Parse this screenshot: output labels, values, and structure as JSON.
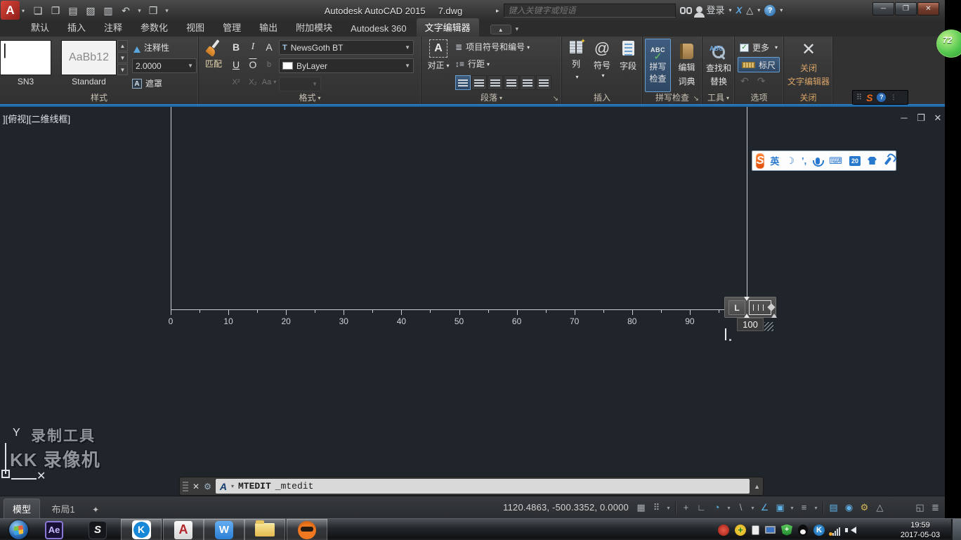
{
  "titlebar": {
    "app_button_label": "A",
    "title_app": "Autodesk AutoCAD 2015",
    "title_doc": "7.dwg",
    "search_placeholder": "键入关键字或短语",
    "signin_label": "登录",
    "exchange_glyph": "X",
    "a360_glyph": "△",
    "help_glyph": "?",
    "quick_access": [
      {
        "name": "qat-new-icon",
        "glyph": "❏"
      },
      {
        "name": "qat-open-icon",
        "glyph": "❐"
      },
      {
        "name": "qat-save-icon",
        "glyph": "▤"
      },
      {
        "name": "qat-saveas-icon",
        "glyph": "▨"
      },
      {
        "name": "qat-plot-icon",
        "glyph": "▥"
      },
      {
        "name": "qat-undo-icon",
        "glyph": "↶"
      },
      {
        "name": "qat-undo-caret-icon",
        "glyph": "▾",
        "sm": true
      },
      {
        "name": "qat-publish-icon",
        "glyph": "❒"
      },
      {
        "name": "qat-customize-caret-icon",
        "glyph": "▾",
        "sm": true
      }
    ],
    "window_buttons": {
      "minimize": "─",
      "restore": "❐",
      "close": "✕"
    }
  },
  "ribbon": {
    "tabs": [
      {
        "id": "home",
        "label": "默认"
      },
      {
        "id": "insert",
        "label": "插入"
      },
      {
        "id": "annotate",
        "label": "注释"
      },
      {
        "id": "parametric",
        "label": "参数化"
      },
      {
        "id": "view",
        "label": "视图"
      },
      {
        "id": "manage",
        "label": "管理"
      },
      {
        "id": "output",
        "label": "输出"
      },
      {
        "id": "addins",
        "label": "附加模块"
      },
      {
        "id": "autodesk-360",
        "label": "Autodesk 360"
      },
      {
        "id": "text-editor",
        "label": "文字编辑器",
        "active": true
      }
    ],
    "panels": {
      "style": {
        "label": "样式",
        "style1_preview": "|",
        "style1_name": "SN3",
        "style2_preview": "AaBb12",
        "style2_name": "Standard",
        "annotative_label": "注释性",
        "height_value": "2.0000",
        "mask_label": "遮罩"
      },
      "format": {
        "label": "格式",
        "match_label": "匹配",
        "bold": "B",
        "italic": "I",
        "tracking": "A",
        "underline": "U",
        "overline": "O",
        "stack": "b",
        "superscript": "X²",
        "subscript": "X₂",
        "case": "Aa",
        "font_icon": "T",
        "font_name": "NewsGoth BT",
        "color_name": "ByLayer"
      },
      "paragraph": {
        "label": "段落",
        "justify_label": "对正",
        "justify_glyph": "A",
        "bullets_label": "项目符号和编号",
        "spacing_label": "行距",
        "align_buttons": [
          "align-default-button",
          "align-left-button",
          "align-center-button",
          "align-right-button",
          "align-justify-button",
          "align-distribute-button"
        ]
      },
      "insert": {
        "label": "插入",
        "columns_label": "列",
        "symbol_label": "符号",
        "symbol_glyph": "@",
        "field_label": "字段"
      },
      "spellcheck": {
        "label": "拼写检查",
        "check_abc": "ABC",
        "check_mark": "✓",
        "check_line1": "拼写",
        "check_line2": "检查",
        "dict_line1": "编辑",
        "dict_line2": "词典"
      },
      "tools": {
        "label": "工具",
        "find_abc": "ABC",
        "find_line1": "查找和",
        "find_line2": "替换"
      },
      "options": {
        "label": "选项",
        "more_label": "更多",
        "check_glyph": "✓",
        "ruler_label": "标尺",
        "undo_glyph": "↶",
        "redo_glyph": "↷"
      },
      "close": {
        "label": "关闭",
        "close_glyph": "✕",
        "button_line1": "关闭",
        "button_line2": "文字编辑器"
      }
    },
    "sogou_status": {
      "dots": "⠿",
      "logo": "S",
      "help": "?"
    }
  },
  "viewport": {
    "view_label": "][俯视][二维线框]",
    "window_buttons": {
      "minimize": "─",
      "restore": "❐",
      "close": "✕"
    },
    "ruler": {
      "min": 0,
      "max": 100,
      "major_step": 10,
      "minor_step": 5,
      "labels": [
        "0",
        "10",
        "20",
        "30",
        "40",
        "50",
        "60",
        "70",
        "80",
        "90",
        "100"
      ]
    },
    "width_grip": {
      "tab_label": "L",
      "tooltip": "100"
    },
    "watermark": [
      "录制工具",
      "KK 录像机"
    ],
    "ucs": {
      "y_label": "Y",
      "x_label": "✕"
    }
  },
  "sogou_toolbar": {
    "logo": "S",
    "icons": [
      {
        "name": "sogou-mode-english",
        "glyph": "英",
        "type": "txt"
      },
      {
        "name": "sogou-halfwidth-moon-icon",
        "glyph": "☽",
        "type": "txt"
      },
      {
        "name": "sogou-punctuation-icon",
        "glyph": "’,",
        "type": "txt"
      },
      {
        "name": "sogou-mic-icon",
        "type": "mic"
      },
      {
        "name": "sogou-keyboard-icon",
        "glyph": "⌨",
        "type": "txt"
      },
      {
        "name": "sogou-anniversary-badge",
        "glyph": "20",
        "type": "badge"
      },
      {
        "name": "sogou-skin-icon",
        "type": "shirt"
      },
      {
        "name": "sogou-settings-wrench-icon",
        "type": "wrench"
      }
    ]
  },
  "command_line": {
    "close_glyph": "✕",
    "tool_glyph": "⚙",
    "pen_glyph": "A",
    "command": "MTEDIT",
    "echo": "_mtedit",
    "expand_glyph": "▲"
  },
  "status_bar": {
    "model_tab": "模型",
    "layout_tab": "布局1",
    "add_tab_glyph": "✦",
    "coordinates": "1120.4863, -500.3352, 0.0000",
    "icons": [
      {
        "name": "grid-display-icon",
        "glyph": "▦"
      },
      {
        "name": "snap-mode-icon",
        "glyph": "⠿"
      },
      {
        "name": "snap-caret-icon",
        "glyph": "▾",
        "caret": true
      },
      {
        "name": "statusbar-separator",
        "sep": true
      },
      {
        "name": "dynamic-input-icon",
        "glyph": "+"
      },
      {
        "name": "ortho-mode-icon",
        "glyph": "∟"
      },
      {
        "name": "polar-tracking-icon",
        "glyph": "◔",
        "accent": "blue"
      },
      {
        "name": "polar-caret-icon",
        "glyph": "▾",
        "caret": true
      },
      {
        "name": "isometric-drafting-icon",
        "glyph": "\\"
      },
      {
        "name": "iso-caret-icon",
        "glyph": "▾",
        "caret": true
      },
      {
        "name": "osnap-tracking-icon",
        "glyph": "∠",
        "accent": "blue"
      },
      {
        "name": "object-snap-icon",
        "glyph": "▣",
        "accent": "blue"
      },
      {
        "name": "osnap-caret-icon",
        "glyph": "▾",
        "caret": true
      },
      {
        "name": "lineweight-icon",
        "glyph": "≡"
      },
      {
        "name": "lineweight-caret-icon",
        "glyph": "▾",
        "caret": true
      },
      {
        "name": "statusbar-separator",
        "sep": true
      },
      {
        "name": "annotation-visibility-icon",
        "glyph": "▤",
        "accent": "blue"
      },
      {
        "name": "annotation-scale-icon",
        "glyph": "◉",
        "accent": "blue"
      },
      {
        "name": "workspace-switching-icon",
        "glyph": "⚙",
        "accent": "gold"
      },
      {
        "name": "annotation-monitor-icon",
        "glyph": "△"
      },
      {
        "name": "statusbar-spacer",
        "spacer": true
      },
      {
        "name": "clean-screen-icon",
        "glyph": "◱"
      },
      {
        "name": "customization-menu-icon",
        "glyph": "≣"
      }
    ]
  },
  "taskbar": {
    "apps": [
      {
        "name": "start-button",
        "style": "start",
        "pressed": false
      },
      {
        "name": "after-effects-app",
        "style": "ae",
        "label": "Ae",
        "pressed": false
      },
      {
        "name": "sogou-pinyin-app",
        "style": "sogou",
        "label": "S",
        "pressed": false
      },
      {
        "name": "kk-recorder-app",
        "style": "kk",
        "label": "K",
        "pressed": true
      },
      {
        "name": "autocad-app",
        "style": "acad",
        "label": "A",
        "pressed": true
      },
      {
        "name": "wps-writer-app",
        "style": "wps",
        "label": "W",
        "pressed": true
      },
      {
        "name": "file-explorer-app",
        "style": "folder",
        "pressed": true
      },
      {
        "name": "wangwang-app",
        "style": "cat",
        "pressed": true
      }
    ],
    "tray": [
      {
        "name": "wangwang-tray-icon",
        "style": "red"
      },
      {
        "name": "safety-plus-tray-icon",
        "style": "plus",
        "glyph": "+"
      },
      {
        "name": "device-clipboard-tray-icon",
        "style": "clip"
      },
      {
        "name": "display-tray-icon",
        "style": "mon"
      },
      {
        "name": "shield-360-tray-icon",
        "style": "shield",
        "glyph": "+"
      },
      {
        "name": "qq-tray-icon",
        "style": "qq"
      },
      {
        "name": "kk-tray-icon",
        "style": "kkb",
        "glyph": "K"
      },
      {
        "name": "network-tray-icon",
        "style": "net"
      },
      {
        "name": "volume-tray-icon",
        "style": "vol"
      }
    ],
    "clock": {
      "time": "19:59",
      "date": "2017-05-03"
    }
  },
  "overlay": {
    "ball_value": "72"
  }
}
